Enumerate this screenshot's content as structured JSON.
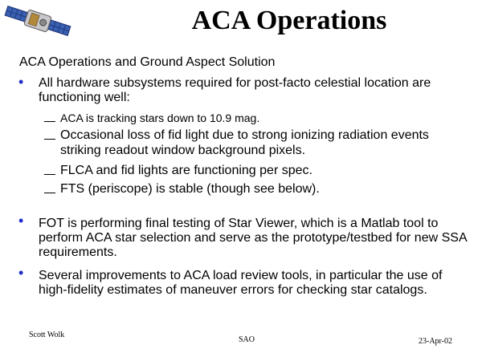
{
  "slide": {
    "title": "ACA Operations",
    "subtitle": "ACA Operations and Ground Aspect Solution",
    "bullets": [
      {
        "text": "All hardware subsystems required for post-facto celestial location are functioning well:",
        "subs": [
          "ACA is tracking stars down to 10.9 mag.",
          "Occasional loss of fid light due to strong ionizing radiation events striking readout window background pixels.",
          "FLCA and fid lights are functioning per spec.",
          "FTS (periscope) is stable (though see below)."
        ]
      },
      {
        "text": "FOT is performing final testing of Star Viewer, which is a Matlab tool to perform ACA star selection and serve as the prototype/testbed for new SSA requirements."
      },
      {
        "text": "Several improvements to ACA load review tools, in particular the use of high-fidelity estimates of maneuver errors for checking star catalogs."
      }
    ],
    "bullet_glyph": "•",
    "dash_glyph": "—",
    "colors": {
      "bullet": "#1e2ec8",
      "text": "#000000",
      "background": "#ffffff"
    }
  },
  "footer": {
    "author": "Scott Wolk",
    "org": "SAO",
    "date": "23-Apr-02"
  },
  "logo_icon": "satellite-icon"
}
